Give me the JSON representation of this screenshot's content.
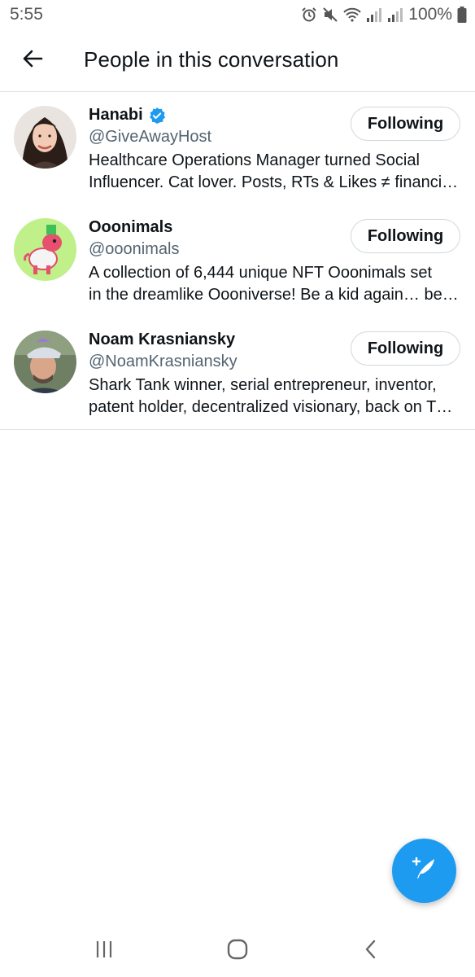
{
  "status_bar": {
    "time": "5:55",
    "battery": "100%",
    "icons": [
      "alarm-icon",
      "mute-icon",
      "wifi-icon",
      "signal-icon",
      "signal-icon",
      "battery-icon"
    ]
  },
  "header": {
    "title": "People in this conversation",
    "back_icon": "arrow-left-icon"
  },
  "people": [
    {
      "name": "Hanabi",
      "verified": true,
      "handle": "@GiveAwayHost",
      "bio_line1": "Healthcare Operations Manager turned Social",
      "bio_line2": "Influencer. Cat lover. Posts, RTs & Likes ≠ financi…",
      "button_label": "Following"
    },
    {
      "name": "Ooonimals",
      "verified": false,
      "handle": "@ooonimals",
      "bio_line1": "A collection of 6,444 unique NFT Ooonimals set",
      "bio_line2": "in the dreamlike Oooniverse! Be a kid again… be…",
      "button_label": "Following"
    },
    {
      "name": "Noam Krasniansky",
      "verified": false,
      "handle": "@NoamKrasniansky",
      "bio_line1": "Shark Tank winner, serial entrepreneur, inventor,",
      "bio_line2": "patent holder, decentralized visionary, back on T…",
      "button_label": "Following"
    }
  ],
  "fab": {
    "icon": "compose-tweet-icon"
  },
  "nav_bar": {
    "icons": [
      "recent-apps-icon",
      "home-icon",
      "back-icon"
    ]
  },
  "colors": {
    "accent": "#1d9bf0",
    "text": "#0f1419",
    "secondary_text": "#536471",
    "border": "#cfd9de"
  }
}
